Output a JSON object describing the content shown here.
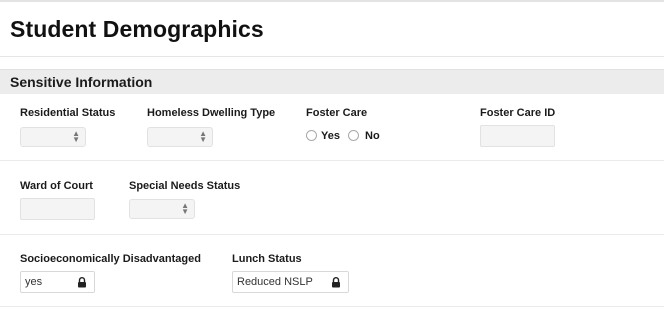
{
  "page": {
    "title": "Student Demographics"
  },
  "section": {
    "title": "Sensitive Information"
  },
  "fields": {
    "residential_status": {
      "label": "Residential Status",
      "value": ""
    },
    "homeless_dwelling_type": {
      "label": "Homeless Dwelling Type",
      "value": ""
    },
    "foster_care": {
      "label": "Foster Care",
      "options": [
        "Yes",
        "No"
      ],
      "selected": null
    },
    "foster_care_id": {
      "label": "Foster Care ID",
      "value": ""
    },
    "ward_of_court": {
      "label": "Ward of Court",
      "value": ""
    },
    "special_needs_status": {
      "label": "Special Needs Status",
      "value": ""
    },
    "socioeconomically_disadvantaged": {
      "label": "Socioeconomically Disadvantaged",
      "value": "yes",
      "locked": true
    },
    "lunch_status": {
      "label": "Lunch Status",
      "value": "Reduced NSLP",
      "locked": true
    }
  },
  "icons": {
    "select_arrows": "updown-arrows-icon",
    "lock": "lock-icon"
  },
  "colors": {
    "field_bg": "#f4f4f4",
    "section_bg": "#ececec",
    "divider": "#ebebeb"
  }
}
